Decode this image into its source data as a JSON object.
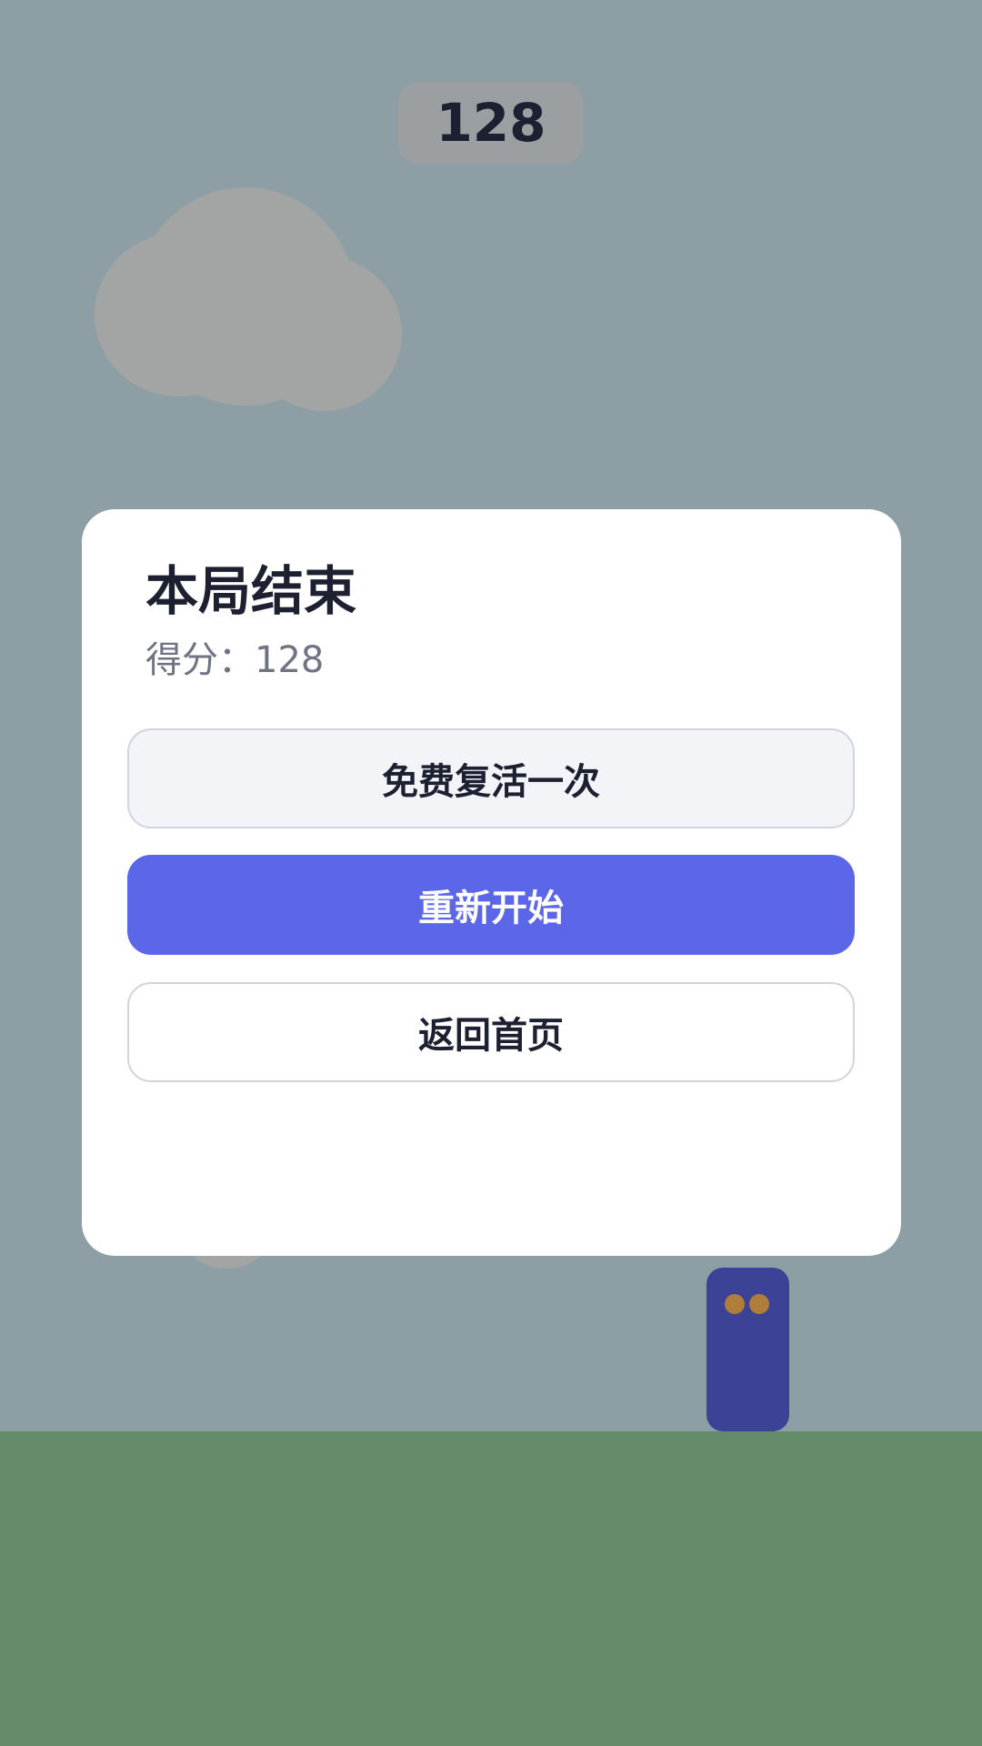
{
  "hud": {
    "score": "128"
  },
  "game_over_dialog": {
    "title": "本局结束",
    "score_text": "得分：128",
    "buttons": {
      "revive_label": "免费复活一次",
      "restart_label": "重新开始",
      "home_label": "返回首页"
    }
  },
  "colors": {
    "sky": "#8e9ea5",
    "ground": "#648c6b",
    "primary_button": "#5b67e8",
    "player": "#3c4296",
    "player_eyes": "#b07d3a",
    "cloud": "#a3a4a4"
  }
}
